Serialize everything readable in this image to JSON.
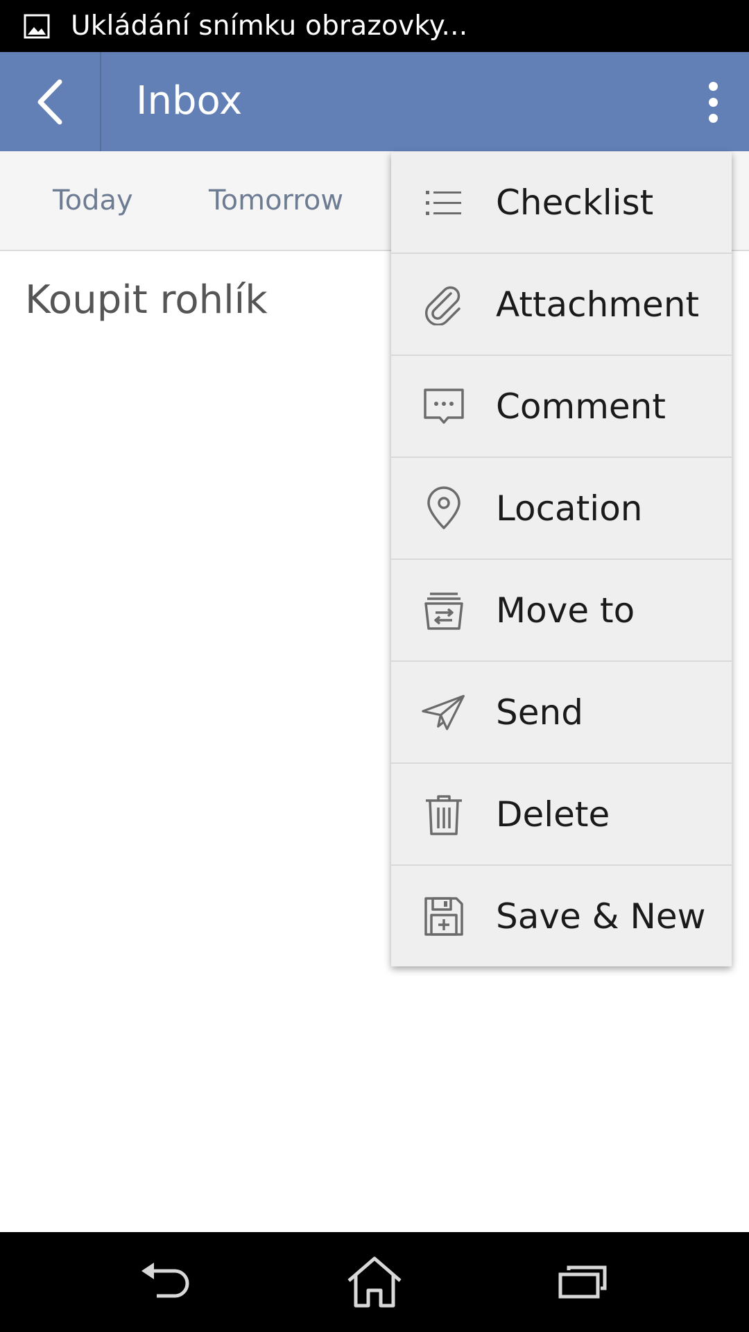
{
  "status_bar": {
    "text": "Ukládání snímku obrazovky...",
    "icon": "image-icon"
  },
  "app_bar": {
    "title": "Inbox",
    "back_icon": "chevron-left-icon",
    "overflow_icon": "more-vert-icon",
    "color": "#6280b5"
  },
  "date_tabs": [
    {
      "label": "Today"
    },
    {
      "label": "Tomorrow"
    }
  ],
  "task": {
    "title": "Koupit rohlík"
  },
  "menu": {
    "items": [
      {
        "label": "Checklist",
        "icon": "checklist-icon"
      },
      {
        "label": "Attachment",
        "icon": "paperclip-icon"
      },
      {
        "label": "Comment",
        "icon": "comment-icon"
      },
      {
        "label": "Location",
        "icon": "location-pin-icon"
      },
      {
        "label": "Move to",
        "icon": "move-to-icon"
      },
      {
        "label": "Send",
        "icon": "paper-plane-icon"
      },
      {
        "label": "Delete",
        "icon": "trash-icon"
      },
      {
        "label": "Save & New",
        "icon": "save-new-icon"
      }
    ]
  },
  "nav_bar": {
    "back_icon": "nav-back-icon",
    "home_icon": "home-icon",
    "recents_icon": "recents-icon"
  }
}
